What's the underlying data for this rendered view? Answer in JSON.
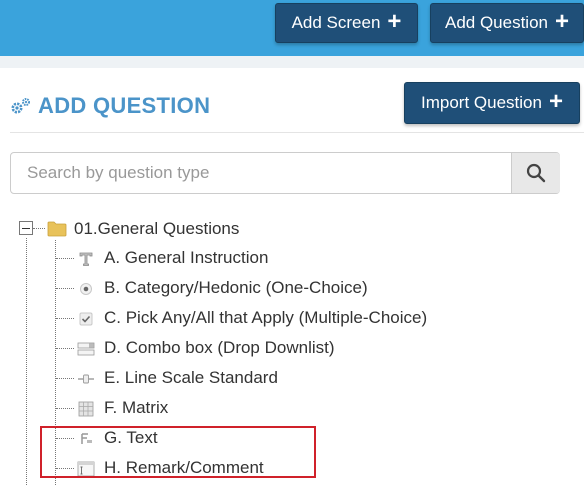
{
  "topbar": {
    "add_screen_label": "Add Screen",
    "add_question_label": "Add Question",
    "background_color": "#3aa3dc",
    "button_color": "#1f4f78"
  },
  "header": {
    "title": "ADD QUESTION",
    "title_color": "#4b94c9",
    "import_label": "Import Question"
  },
  "search": {
    "placeholder": "Search by question type",
    "value": ""
  },
  "tree": {
    "root_label": "01.General Questions",
    "items": [
      {
        "label": "A. General Instruction",
        "icon": "text-type-icon"
      },
      {
        "label": "B. Category/Hedonic (One-Choice)",
        "icon": "radio-icon"
      },
      {
        "label": "C. Pick Any/All that Apply (Multiple-Choice)",
        "icon": "checkbox-icon"
      },
      {
        "label": "D. Combo box (Drop Downlist)",
        "icon": "combobox-icon"
      },
      {
        "label": "E. Line Scale Standard",
        "icon": "line-scale-icon"
      },
      {
        "label": "F. Matrix",
        "icon": "matrix-icon"
      },
      {
        "label": "G. Text",
        "icon": "text-field-icon"
      },
      {
        "label": "H. Remark/Comment",
        "icon": "textarea-icon"
      }
    ]
  },
  "highlight_color": "#d0212a"
}
